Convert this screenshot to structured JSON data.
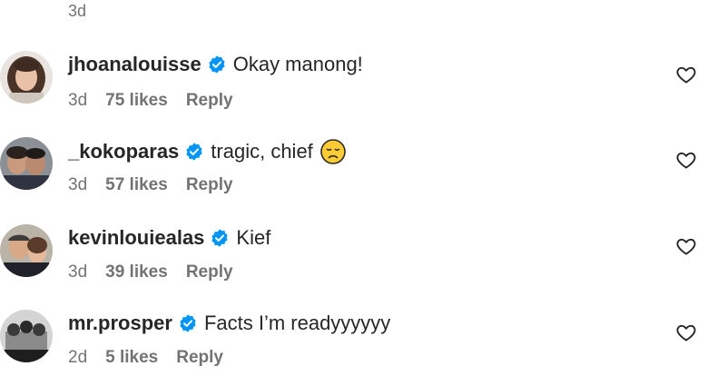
{
  "top_meta": {
    "time": "3d"
  },
  "comments": [
    {
      "username": "jhoanalouisse",
      "text": "Okay manong!",
      "time": "3d",
      "likes": "75 likes",
      "reply": "Reply"
    },
    {
      "username": "_kokoparas",
      "text": "tragic, chief",
      "emoji": "disappointed-face",
      "time": "3d",
      "likes": "57 likes",
      "reply": "Reply"
    },
    {
      "username": "kevinlouiealas",
      "text": "Kief",
      "time": "3d",
      "likes": "39 likes",
      "reply": "Reply"
    },
    {
      "username": "mr.prosper",
      "text": "Facts I’m readyyyyyy",
      "time": "2d",
      "likes": "5 likes",
      "reply": "Reply"
    }
  ],
  "colors": {
    "verified": "#0095f6",
    "muted": "#737373",
    "text": "#262626"
  },
  "icons": {
    "verified": "verified-badge-icon",
    "like": "heart-outline-icon"
  }
}
